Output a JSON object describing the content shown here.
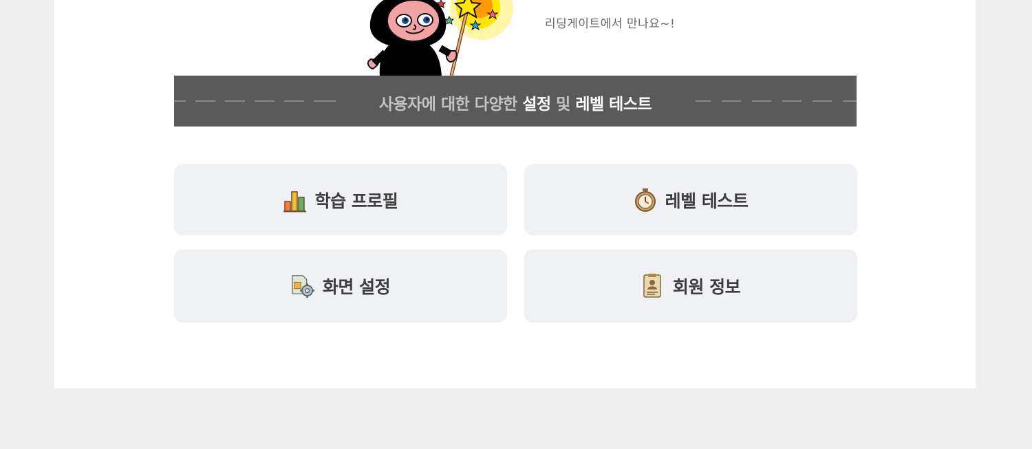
{
  "greeting": "리딩게이트에서 만나요~!",
  "banner": {
    "part1": "사용자에 대한 다양한",
    "part2": "설정",
    "part3": "및",
    "part4": "레벨 테스트"
  },
  "menu": {
    "profile": {
      "label": "학습 프로필",
      "icon": "bar-chart-icon"
    },
    "level_test": {
      "label": "레벨 테스트",
      "icon": "stopwatch-icon"
    },
    "screen_settings": {
      "label": "화면 설정",
      "icon": "image-gear-icon"
    },
    "member_info": {
      "label": "회원 정보",
      "icon": "id-document-icon"
    }
  },
  "colors": {
    "banner_bg": "#5a5a5a",
    "card_bg": "#f0f1f5",
    "page_bg": "#efefef"
  }
}
